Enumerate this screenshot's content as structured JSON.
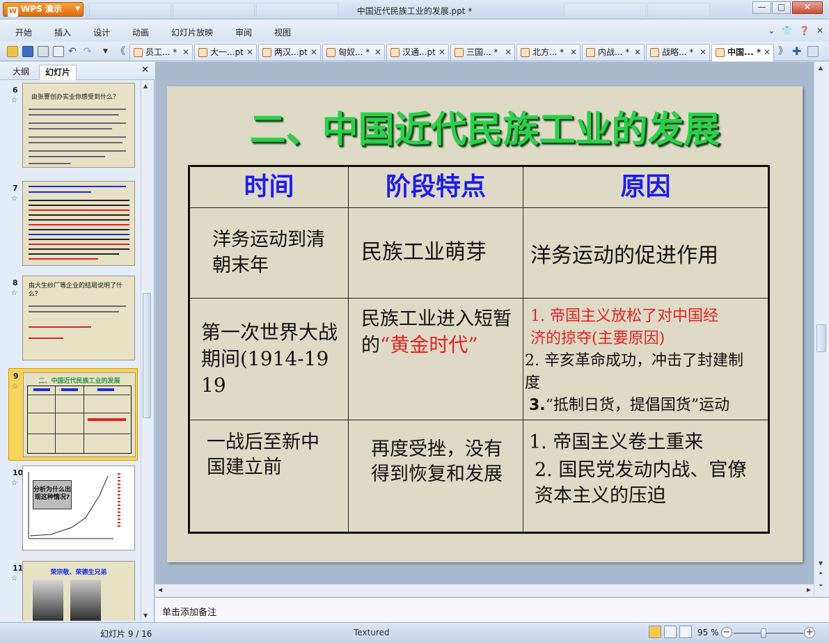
{
  "app": {
    "name": "WPS 演示",
    "window_title": "中国近代民族工业的发展.ppt *"
  },
  "menu": [
    "开始",
    "插入",
    "设计",
    "动画",
    "幻灯片放映",
    "审阅",
    "视图"
  ],
  "doc_tabs": [
    {
      "label": "员工... *"
    },
    {
      "label": "大一...pt"
    },
    {
      "label": "两汉...pt"
    },
    {
      "label": "匈奴... *"
    },
    {
      "label": "汉通...pt"
    },
    {
      "label": "三国... *"
    },
    {
      "label": "北方... *"
    },
    {
      "label": "内战... *"
    },
    {
      "label": "战略... *"
    },
    {
      "label": "中国... *"
    }
  ],
  "panel": {
    "tab_outline": "大纲",
    "tab_slides": "幻灯片"
  },
  "thumbnails": [
    {
      "num": "6",
      "title": "由张謇创办实业你感受到什么？"
    },
    {
      "num": "7",
      "title": ""
    },
    {
      "num": "8",
      "title": "由大生纱厂等企业的结局说明了什么？"
    },
    {
      "num": "9",
      "title": "二、中国近代民族工业的发展"
    },
    {
      "num": "10",
      "title": "分析为什么出现这种情况?"
    },
    {
      "num": "11",
      "title": "荣宗敬、荣德生兄弟"
    }
  ],
  "slide": {
    "title": "二、中国近代民族工业的发展",
    "headers": [
      "时间",
      "阶段特点",
      "原因"
    ],
    "rows": [
      {
        "time": "洋务运动到清朝末年",
        "feature": "民族工业萌芽",
        "reason": "洋务运动的促进作用"
      },
      {
        "time": "第一次世界大战期间(1914-1919",
        "feature_a": "民族工业进入短暂的",
        "feature_b": "“黄金时代”",
        "reason_1": "1. 帝国主义放松了对中国经济的掠夺(主要原因)",
        "reason_2": "2. 辛亥革命成功，冲击了封建制度",
        "reason_3a": "3.",
        "reason_3b": "“抵制日货，提倡国货”运动"
      },
      {
        "time": "一战后至新中国建立前",
        "feature": "再度受挫，没有得到恢复和发展",
        "reason_1": "1. 帝国主义卷土重来",
        "reason_2": "2. 国民党发动内战、官僚资本主义的压迫"
      }
    ]
  },
  "notes_placeholder": "单击添加备注",
  "status": {
    "slide_counter": "幻灯片 9 / 16",
    "theme": "Textured",
    "zoom": "95 %"
  },
  "colors": {
    "title_green": "#2bd04a",
    "header_blue": "#1c1cf0",
    "highlight_red": "#e52222",
    "slide_bg": "#dfdac6"
  }
}
